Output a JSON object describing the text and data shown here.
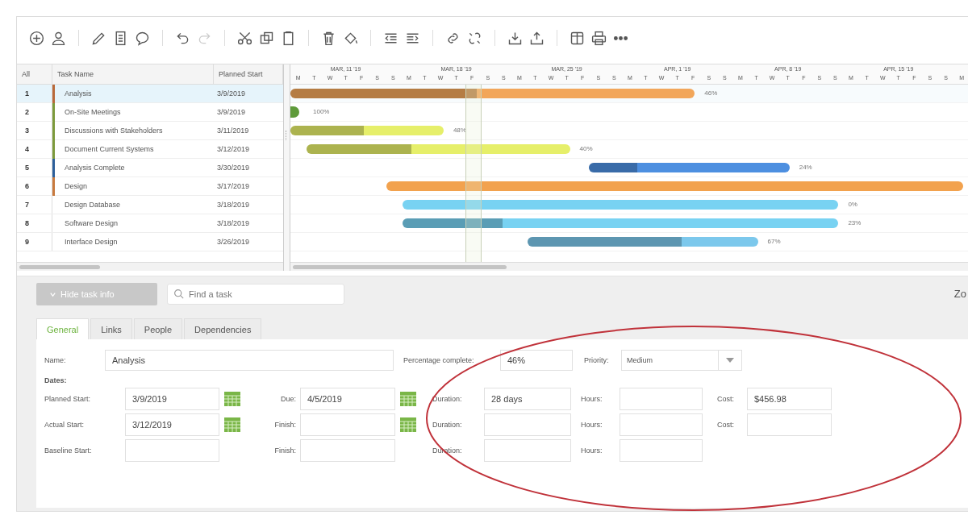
{
  "toolbar": [
    [
      {
        "kind": "add",
        "disabled": false
      },
      {
        "kind": "user",
        "disabled": false
      }
    ],
    [
      {
        "kind": "edit",
        "disabled": false
      },
      {
        "kind": "note",
        "disabled": false
      },
      {
        "kind": "comment",
        "disabled": false
      }
    ],
    [
      {
        "kind": "undo",
        "disabled": false
      },
      {
        "kind": "redo",
        "disabled": true
      }
    ],
    [
      {
        "kind": "cut",
        "disabled": false
      },
      {
        "kind": "copy",
        "disabled": false
      },
      {
        "kind": "paste",
        "disabled": false
      }
    ],
    [
      {
        "kind": "trash",
        "disabled": false
      },
      {
        "kind": "bucket",
        "disabled": false
      }
    ],
    [
      {
        "kind": "outdent",
        "disabled": false
      },
      {
        "kind": "indent",
        "disabled": false
      }
    ],
    [
      {
        "kind": "link",
        "disabled": false
      },
      {
        "kind": "unlink",
        "disabled": false
      }
    ],
    [
      {
        "kind": "download",
        "disabled": false
      },
      {
        "kind": "upload",
        "disabled": false
      }
    ],
    [
      {
        "kind": "columns",
        "disabled": false
      },
      {
        "kind": "print",
        "disabled": false
      },
      {
        "kind": "more",
        "disabled": false
      }
    ]
  ],
  "table": {
    "columns": [
      "All",
      "Task Name",
      "Planned Start"
    ],
    "rows": [
      {
        "num": "1",
        "name": "Analysis",
        "start": "3/9/2019",
        "selected": true,
        "color": "#b8693a",
        "bar": {
          "kind": "bar",
          "color": "#f2a65a",
          "level": 0.46,
          "label": "46%"
        }
      },
      {
        "num": "2",
        "name": "On-Site Meetings",
        "start": "3/9/2019",
        "selected": false,
        "color": "#7d9a3c",
        "bar": {
          "kind": "milestone",
          "color": "#5e9a3a",
          "label": "100%"
        }
      },
      {
        "num": "3",
        "name": "Discussions with Stakeholders",
        "start": "3/11/2019",
        "selected": false,
        "color": "#7d9a3c",
        "bar": {
          "kind": "bar",
          "color": "#e6ef6a",
          "level": 0.48,
          "label": "48%"
        }
      },
      {
        "num": "4",
        "name": "Document Current Systems",
        "start": "3/12/2019",
        "selected": false,
        "color": "#7d9a3c",
        "bar": {
          "kind": "bar",
          "color": "#e6ef6a",
          "level": 0.4,
          "label": "40%"
        }
      },
      {
        "num": "5",
        "name": "Analysis Complete",
        "start": "3/30/2019",
        "selected": false,
        "color": "#2d5f9a",
        "bar": {
          "kind": "bar",
          "color": "#4d8fe0",
          "level": 0.24,
          "label": "24%"
        }
      },
      {
        "num": "6",
        "name": "Design",
        "start": "3/17/2019",
        "selected": false,
        "color": "#c87a3e",
        "bar": {
          "kind": "bar",
          "color": "#f2a24e"
        }
      },
      {
        "num": "7",
        "name": "Design Database",
        "start": "3/18/2019",
        "selected": false,
        "bar": {
          "kind": "bar",
          "color": "#78d2f2",
          "label": "0%"
        }
      },
      {
        "num": "8",
        "name": "Software Design",
        "start": "3/18/2019",
        "selected": false,
        "bar": {
          "kind": "bar",
          "color": "#78d2f2",
          "level": 0.23,
          "label": "23%"
        }
      },
      {
        "num": "9",
        "name": "Interface Design",
        "start": "3/26/2019",
        "selected": false,
        "bar": {
          "kind": "bar",
          "color": "#7cc8ec",
          "level": 0.67,
          "label": "67%"
        }
      }
    ]
  },
  "timeline": {
    "weeks": [
      {
        "label": "MAR, 11 '19",
        "days": [
          "M",
          "T",
          "W",
          "T",
          "F",
          "S",
          "S"
        ]
      },
      {
        "label": "MAR, 18 '19",
        "days": [
          "M",
          "T",
          "W",
          "T",
          "F",
          "S",
          "S"
        ]
      },
      {
        "label": "MAR, 25 '19",
        "days": [
          "M",
          "T",
          "W",
          "T",
          "F",
          "S",
          "S"
        ]
      },
      {
        "label": "APR, 1 '19",
        "days": [
          "M",
          "T",
          "W",
          "T",
          "F",
          "S",
          "S"
        ]
      },
      {
        "label": "APR, 8 '19",
        "days": [
          "M",
          "T",
          "W",
          "T",
          "F",
          "S",
          "S"
        ]
      },
      {
        "label": "APR, 15 '19",
        "days": [
          "M",
          "T",
          "W",
          "T",
          "F",
          "S",
          "S"
        ]
      },
      {
        "days": [
          "M"
        ]
      }
    ]
  },
  "task_info": {
    "hide_button": "Hide task info",
    "search": {
      "placeholder": "Find a task"
    },
    "zoom_label": "Zo",
    "tabs": [
      {
        "label": "General",
        "selected": true
      },
      {
        "label": "Links",
        "selected": false
      },
      {
        "label": "People",
        "selected": false
      },
      {
        "label": "Dependencies",
        "selected": false
      }
    ],
    "name": {
      "label": "Name:",
      "value": "Analysis"
    },
    "percent": {
      "label": "Percentage complete:",
      "value": "46%"
    },
    "priority": {
      "label": "Priority:",
      "value": "Medium"
    },
    "dates_heading": "Dates:",
    "date_rows": [
      [
        {
          "kind": "date",
          "label": "Planned Start:",
          "value": "3/9/2019"
        },
        {
          "kind": "date",
          "label": "Due:",
          "value": "4/5/2019"
        },
        {
          "kind": "text",
          "label": "Duration:",
          "value": "28 days"
        },
        {
          "kind": "text",
          "label": "Hours:"
        },
        {
          "kind": "text",
          "label": "Cost:",
          "value": "$456.98"
        }
      ],
      [
        {
          "kind": "date",
          "label": "Actual Start:",
          "value": "3/12/2019"
        },
        {
          "kind": "date",
          "label": "Finish:"
        },
        {
          "kind": "text",
          "label": "Duration:"
        },
        {
          "kind": "text",
          "label": "Hours:"
        },
        {
          "kind": "text",
          "label": "Cost:"
        }
      ],
      [
        {
          "kind": "text",
          "label": "Baseline Start:"
        },
        {
          "kind": "text",
          "label": "Finish:"
        },
        {
          "kind": "text",
          "label": "Duration:"
        },
        {
          "kind": "text",
          "label": "Hours:"
        }
      ]
    ]
  },
  "annotations": [
    {
      "kind": "ellipse"
    }
  ]
}
